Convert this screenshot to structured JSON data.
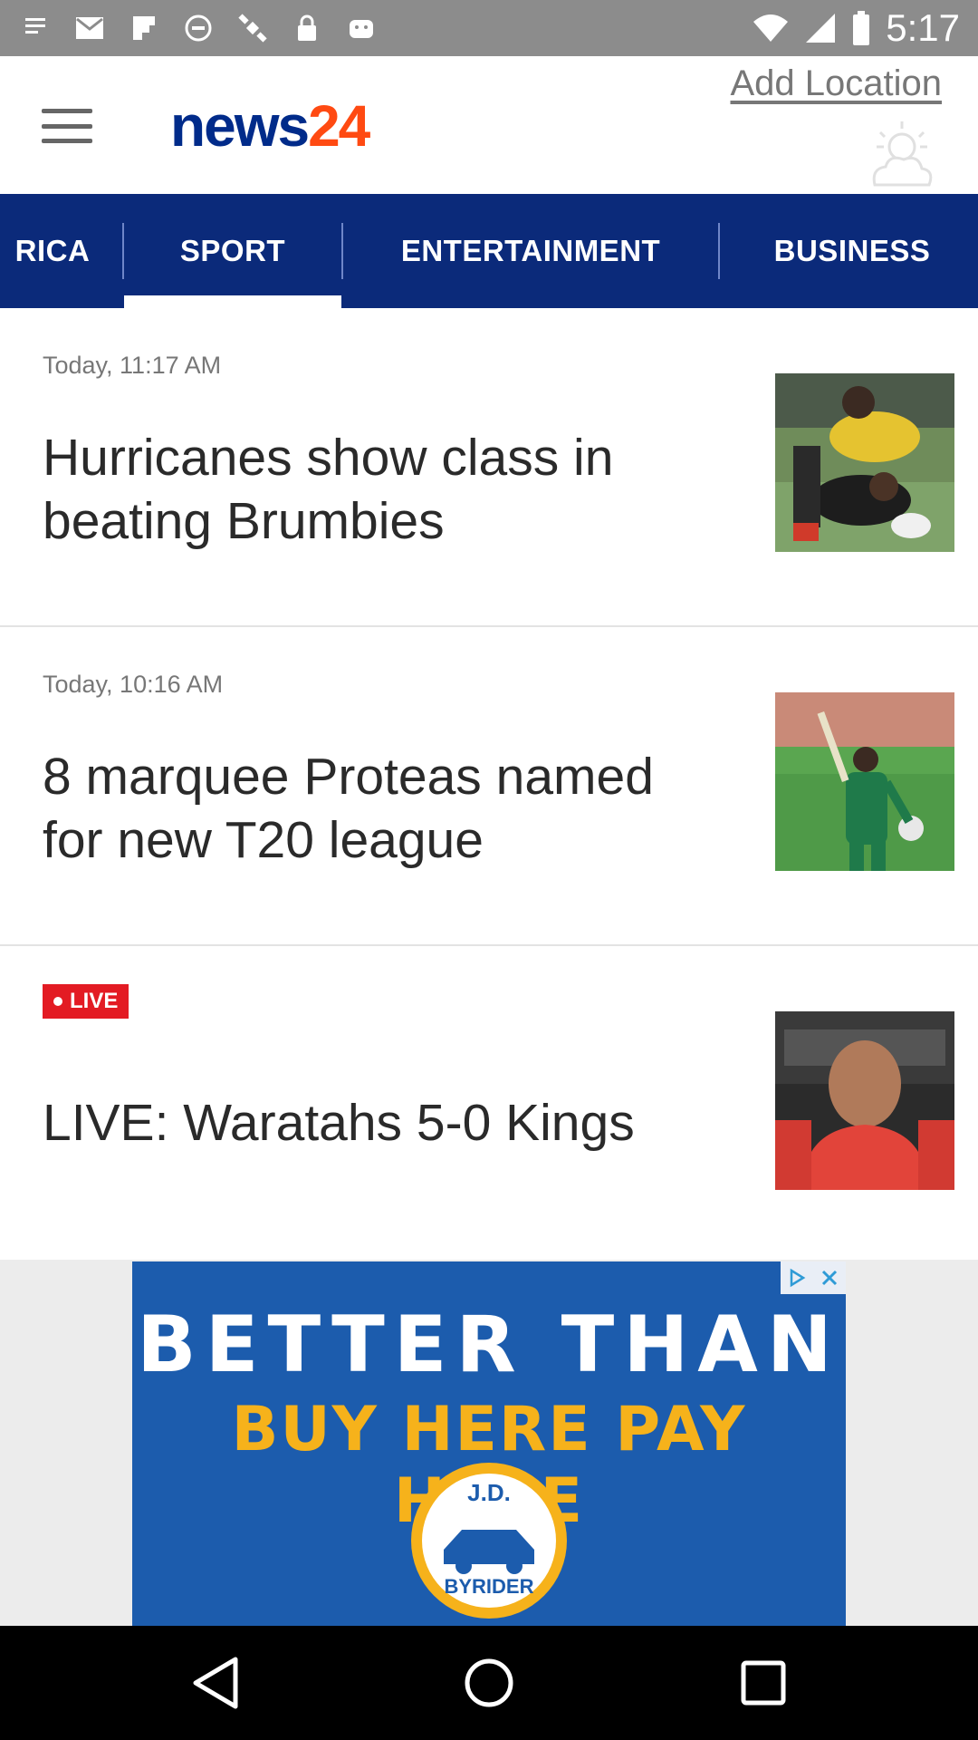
{
  "status_bar": {
    "time": "5:17",
    "icons": [
      "notification-icon",
      "mail-icon",
      "flipboard-icon",
      "circle-status-icon",
      "satellite-icon",
      "lock-icon",
      "android-icon"
    ],
    "right_icons": [
      "wifi-icon",
      "signal-icon",
      "battery-icon"
    ]
  },
  "header": {
    "logo_text_1": "news",
    "logo_text_2": "24",
    "add_location": "Add Location"
  },
  "tabs": [
    {
      "label": "RICA",
      "active": false
    },
    {
      "label": "SPORT",
      "active": true
    },
    {
      "label": "ENTERTAINMENT",
      "active": false
    },
    {
      "label": "BUSINESS",
      "active": false
    }
  ],
  "articles": [
    {
      "meta": "Today, 11:17 AM",
      "title": "Hurricanes show class in beating Brumbies"
    },
    {
      "meta": "Today, 10:16 AM",
      "title": "8 marquee Proteas named for new T20 league"
    },
    {
      "badge": "LIVE",
      "title": "LIVE: Waratahs 5-0 Kings"
    }
  ],
  "ad": {
    "line1": "BETTER THAN",
    "line2": "BUY HERE PAY HERE",
    "logo_line1": "J.D.",
    "logo_line2": "BYRIDER"
  },
  "colors": {
    "tab_bar": "#0b2a7a",
    "logo_blue": "#002b8a",
    "logo_orange": "#ff4a12",
    "live_red": "#e31b23",
    "ad_blue": "#1c5cad",
    "ad_yellow": "#f6b21b"
  }
}
